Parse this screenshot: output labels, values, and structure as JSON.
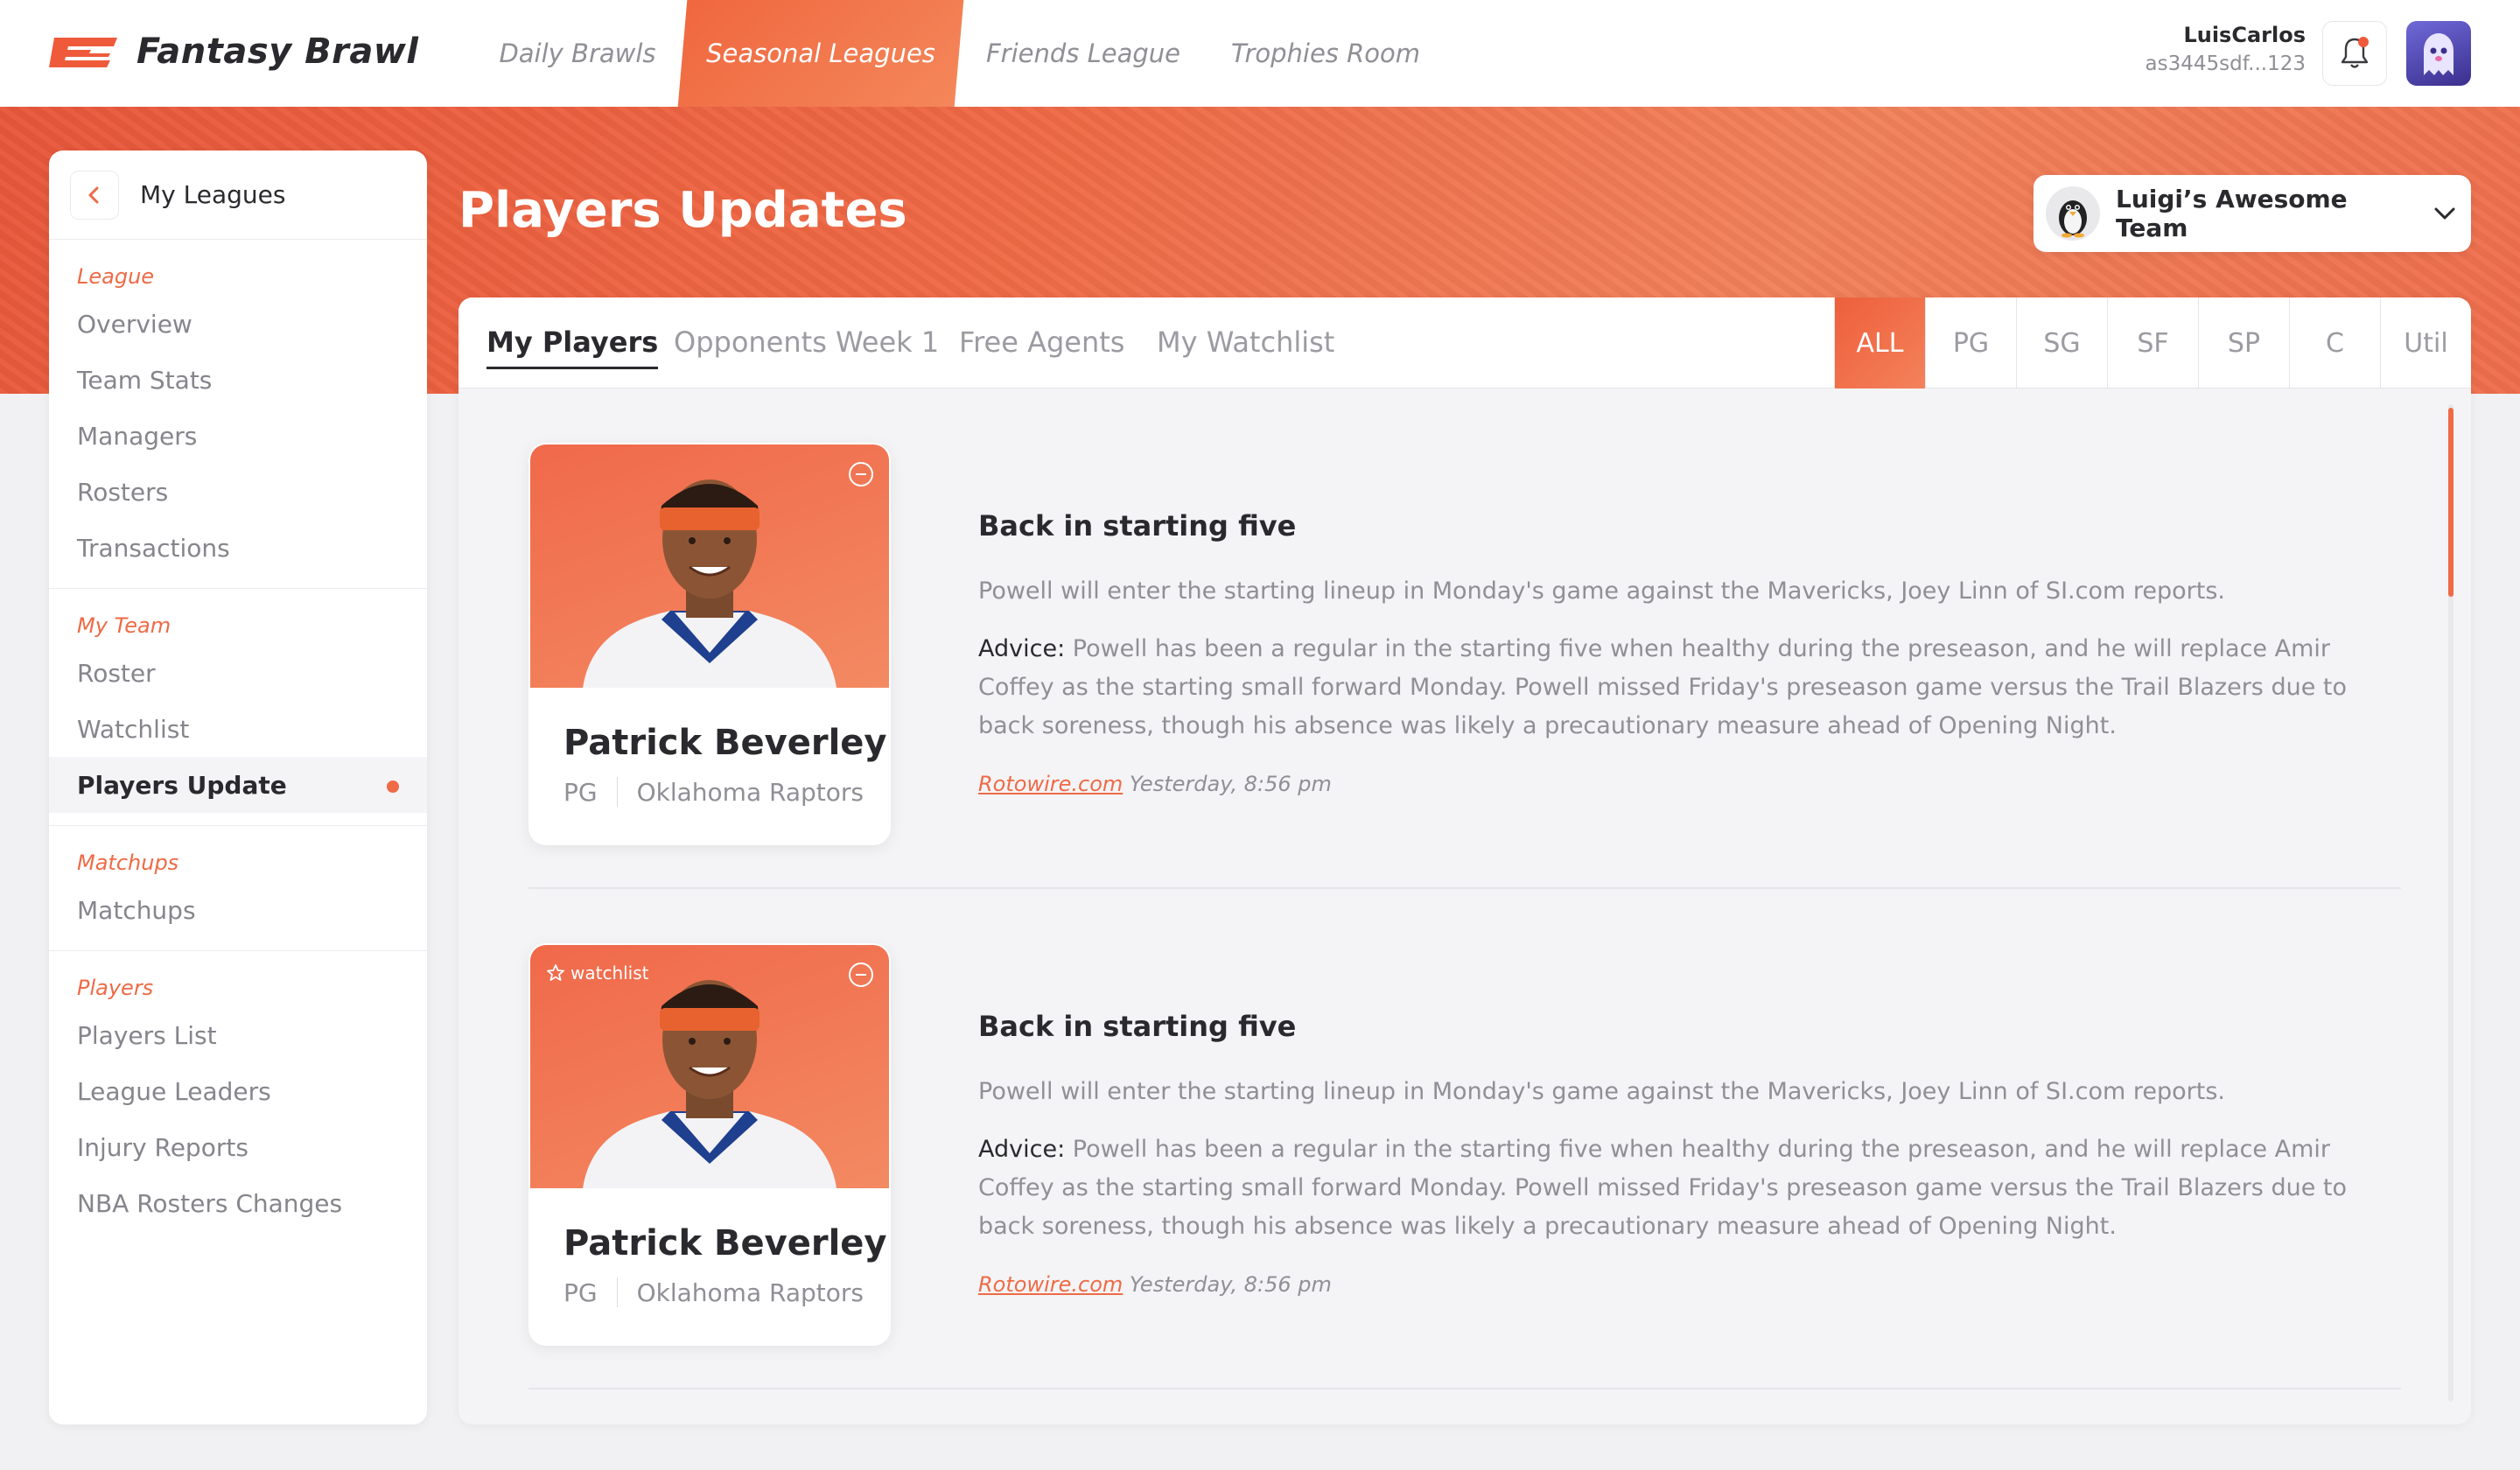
{
  "app": {
    "title": "Fantasy Brawl"
  },
  "nav": {
    "tabs": [
      {
        "label": "Daily Brawls"
      },
      {
        "label": "Seasonal Leagues"
      },
      {
        "label": "Friends League"
      },
      {
        "label": "Trophies Room"
      }
    ]
  },
  "user": {
    "name": "LuisCarlos",
    "id": "as3445sdf...123"
  },
  "sidebar": {
    "title": "My Leagues",
    "groups": [
      {
        "title": "League",
        "items": [
          "Overview",
          "Team Stats",
          "Managers",
          "Rosters",
          "Transactions"
        ]
      },
      {
        "title": "My Team",
        "items": [
          "Roster",
          "Watchlist",
          "Players Update"
        ]
      },
      {
        "title": "Matchups",
        "items": [
          "Matchups"
        ]
      },
      {
        "title": "Players",
        "items": [
          "Players List",
          "League Leaders",
          "Injury Reports",
          "NBA Rosters Changes"
        ]
      }
    ]
  },
  "page": {
    "title": "Players Updates"
  },
  "team": {
    "name": "Luigi’s Awesome Team"
  },
  "tabs": [
    "My Players",
    "Opponents Week 1",
    "Free Agents",
    "My Watchlist"
  ],
  "positions": [
    "ALL",
    "PG",
    "SG",
    "SF",
    "SP",
    "C",
    "Util"
  ],
  "updates": [
    {
      "watchlist": "",
      "player": {
        "name": "Patrick Beverley",
        "position": "PG",
        "team": "Oklahoma Raptors"
      },
      "title": "Back in starting five",
      "body": "Powell will enter the starting lineup in Monday's game against the Mavericks, Joey Linn of SI.com reports.",
      "advice_label": "Advice:",
      "advice": " Powell has been a regular in the starting five when healthy during the preseason, and he will replace Amir Coffey as the starting small forward Monday. Powell missed Friday's preseason game versus the Trail Blazers due to back soreness, though his absence was likely a precautionary measure ahead of Opening Night.",
      "source": "Rotowire.com",
      "time": " Yesterday, 8:56 pm"
    },
    {
      "watchlist": "watchlist",
      "player": {
        "name": "Patrick Beverley",
        "position": "PG",
        "team": "Oklahoma Raptors"
      },
      "title": "Back in starting five",
      "body": "Powell will enter the starting lineup in Monday's game against the Mavericks, Joey Linn of SI.com reports.",
      "advice_label": "Advice:",
      "advice": " Powell has been a regular in the starting five when healthy during the preseason, and he will replace Amir Coffey as the starting small forward Monday. Powell missed Friday's preseason game versus the Trail Blazers due to back soreness, though his absence was likely a precautionary measure ahead of Opening Night.",
      "source": "Rotowire.com",
      "time": " Yesterday, 8:56 pm"
    }
  ],
  "colors": {
    "accent": "#ef6a46",
    "text": "#2a2a2e",
    "muted": "#8f8f96"
  }
}
